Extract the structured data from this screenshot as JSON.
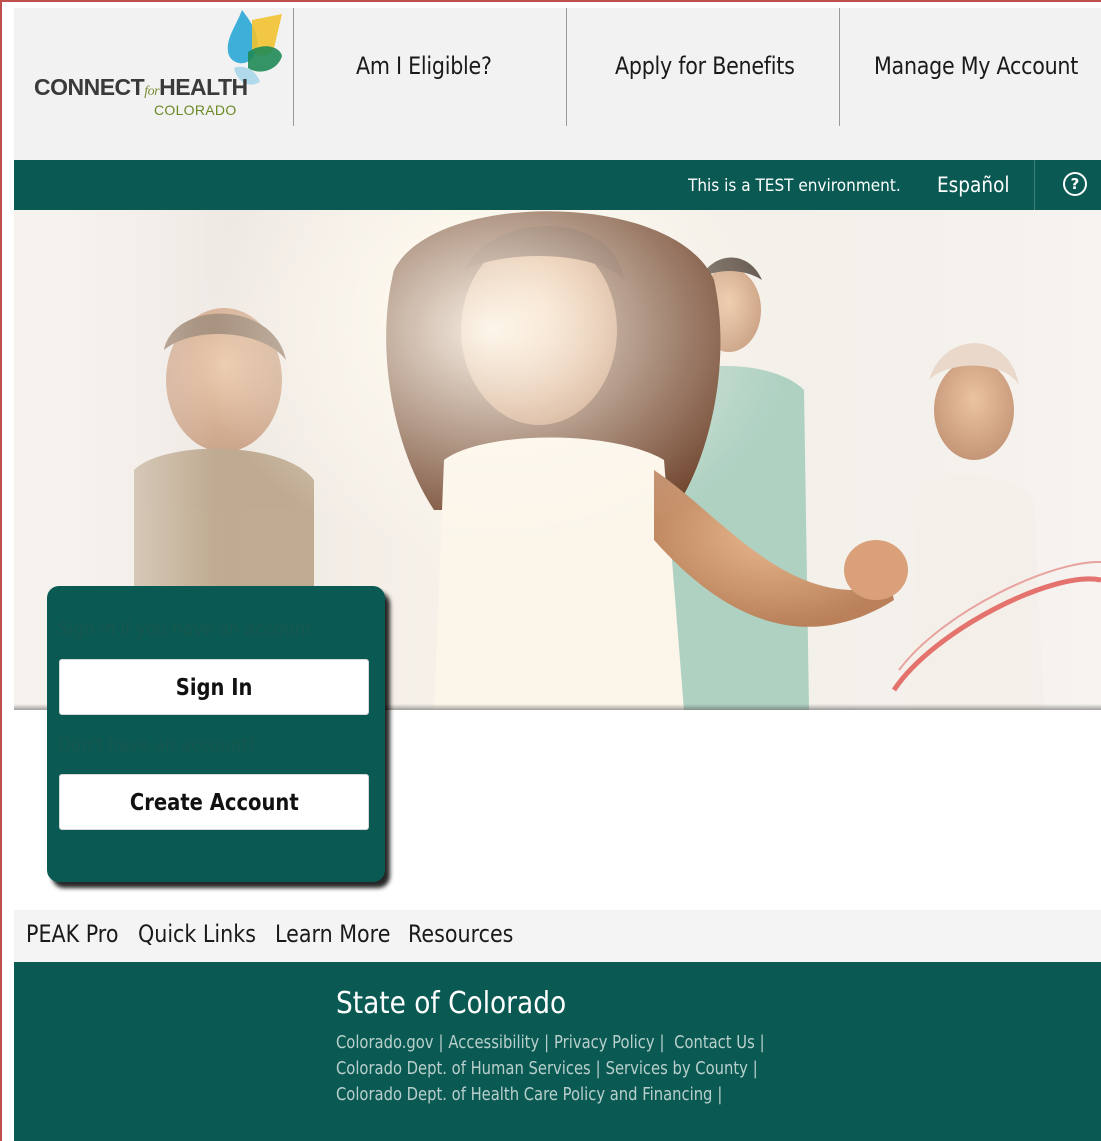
{
  "header": {
    "logo": {
      "brand_left": "CONNECT",
      "brand_for": "for",
      "brand_right": "HEALTH",
      "brand_sub": "COLORADO"
    },
    "nav": [
      {
        "label": "Am I Eligible?"
      },
      {
        "label": "Apply for Benefits"
      },
      {
        "label": "Manage My Account"
      }
    ]
  },
  "utility_bar": {
    "environment_notice": "This is a TEST environment.",
    "language_link": "Español",
    "help_icon_glyph": "?"
  },
  "signin_panel": {
    "signin_hint": "Sign in if you have an account",
    "signin_button": "Sign In",
    "create_hint": "Don't have an account?",
    "create_button": "Create Account"
  },
  "quick_links": [
    {
      "label": "PEAK Pro"
    },
    {
      "label": "Quick Links"
    },
    {
      "label": "Learn More"
    },
    {
      "label": "Resources"
    }
  ],
  "footer": {
    "title": "State of Colorado",
    "links": [
      {
        "label": "Colorado.gov"
      },
      {
        "label": "Accessibility"
      },
      {
        "label": "Privacy Policy"
      },
      {
        "label": "Contact Us"
      },
      {
        "label": "Colorado Dept. of Human Services"
      },
      {
        "label": "Services by County"
      },
      {
        "label": "Colorado Dept. of Health Care Policy and Financing"
      }
    ],
    "separator": "|"
  },
  "colors": {
    "brand_teal": "#0a5a53",
    "logo_green": "#7a8f3a",
    "logo_blue": "#2aa7d6",
    "logo_yellow": "#f2c230"
  },
  "icons": {
    "help": "help-circle-icon",
    "logo_mark": "leaf-droplet-logo-icon"
  }
}
